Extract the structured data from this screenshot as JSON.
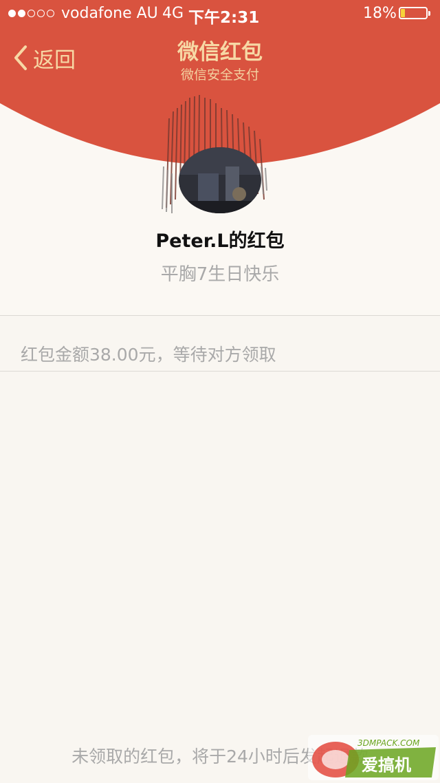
{
  "status_bar": {
    "signal_filled": 2,
    "signal_total": 5,
    "carrier": "vodafone AU",
    "network": "4G",
    "time": "下午2:31",
    "battery_percent_label": "18%",
    "battery_level": 0.18
  },
  "nav": {
    "back_label": "返回",
    "title": "微信红包",
    "subtitle": "微信安全支付"
  },
  "envelope": {
    "sender_title": "Peter.L的红包",
    "wish_message": "平胸7生日快乐"
  },
  "status": {
    "amount_message": "红包金额38.00元，等待对方领取"
  },
  "footer": {
    "refund_notice": "未领取的红包，将于24小时后发起退款"
  },
  "watermark": {
    "site_text": "3DMPACK.COM",
    "brand_text": "爱搞机"
  },
  "colors": {
    "header_red": "#d9533f",
    "nav_gold": "#f7d8a5",
    "page_bg": "#f9f6f1",
    "muted_text": "#a9a9a9",
    "battery_fill": "#f7d23a"
  },
  "icons": {
    "back": "chevron-left-icon",
    "avatar": "user-avatar"
  }
}
